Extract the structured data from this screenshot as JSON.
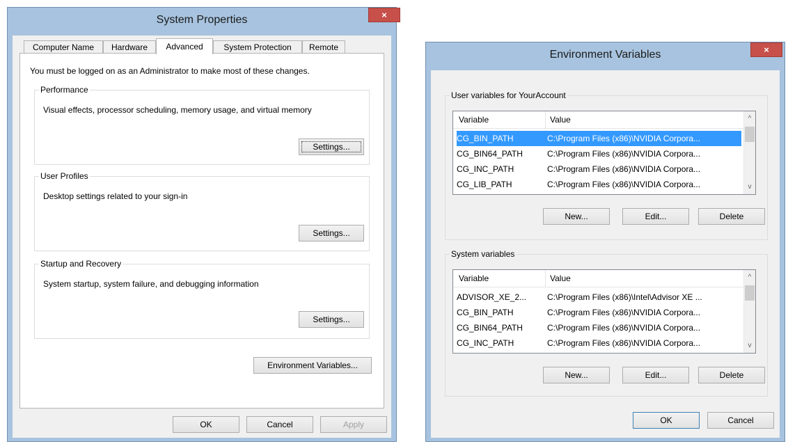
{
  "left_window": {
    "title": "System Properties",
    "close_glyph": "×",
    "tabs": [
      "Computer Name",
      "Hardware",
      "Advanced",
      "System Protection",
      "Remote"
    ],
    "admin_note": "You must be logged on as an Administrator to make most of these changes.",
    "performance": {
      "title": "Performance",
      "description": "Visual effects, processor scheduling, memory usage, and virtual memory",
      "button": "Settings..."
    },
    "user_profiles": {
      "title": "User Profiles",
      "description": "Desktop settings related to your sign-in",
      "button": "Settings..."
    },
    "startup_recovery": {
      "title": "Startup and Recovery",
      "description": "System startup, system failure, and debugging information",
      "button": "Settings..."
    },
    "env_button": "Environment Variables...",
    "ok": "OK",
    "cancel": "Cancel",
    "apply": "Apply"
  },
  "right_window": {
    "title": "Environment Variables",
    "close_glyph": "×",
    "user_group_title": "User variables for YourAccount",
    "system_group_title": "System variables",
    "columns": [
      "Variable",
      "Value"
    ],
    "user_vars": [
      {
        "name": "CG_BIN_PATH",
        "value": "C:\\Program Files (x86)\\NVIDIA Corpora..."
      },
      {
        "name": "CG_BIN64_PATH",
        "value": "C:\\Program Files (x86)\\NVIDIA Corpora..."
      },
      {
        "name": "CG_INC_PATH",
        "value": "C:\\Program Files (x86)\\NVIDIA Corpora..."
      },
      {
        "name": "CG_LIB_PATH",
        "value": "C:\\Program Files (x86)\\NVIDIA Corpora..."
      }
    ],
    "system_vars": [
      {
        "name": "ADVISOR_XE_2...",
        "value": "C:\\Program Files (x86)\\Intel\\Advisor XE ..."
      },
      {
        "name": "CG_BIN_PATH",
        "value": "C:\\Program Files (x86)\\NVIDIA Corpora..."
      },
      {
        "name": "CG_BIN64_PATH",
        "value": "C:\\Program Files (x86)\\NVIDIA Corpora..."
      },
      {
        "name": "CG_INC_PATH",
        "value": "C:\\Program Files (x86)\\NVIDIA Corpora..."
      }
    ],
    "user_buttons": {
      "new": "New...",
      "edit": "Edit...",
      "delete": "Delete"
    },
    "system_buttons": {
      "new": "New...",
      "edit": "Edit...",
      "delete": "Delete"
    },
    "ok": "OK",
    "cancel": "Cancel",
    "scroll_up": "^",
    "scroll_down": "v"
  },
  "colors": {
    "frame": "#a7c3df",
    "close": "#c7504a",
    "selection": "#3399ff"
  }
}
